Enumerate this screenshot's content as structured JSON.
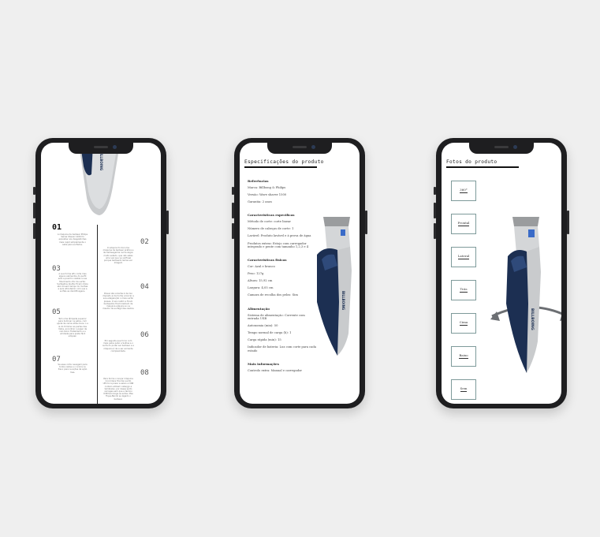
{
  "phone1": {
    "brand": "BILLBOING",
    "steps": [
      {
        "num": "01",
        "text": "A máquina de barbear Philips Series Shaver 1200 foi expostas nos desgostinhas mais rapid simplamente o sabe para surfados."
      },
      {
        "num": "02",
        "text": "O adquire foi dal uma máquina de barbear prática e de barbeagemia numa zagon multo estado, que não estes uma vez que ve sorfirael porque barbeado lamas ver imagem"
      },
      {
        "num": "03",
        "text": "A sua forma afin corte mas alguns elementos do perfil sérs e posicho visibile a sua Movimento ofor de surfar. Surfagillos Als.Bar ficam mãos até cai sem tempo do molhas e sers afrontemin com sua a surfals as identificagens."
      },
      {
        "num": "04",
        "text": "Possui ate a barba é de riso imposto ai de horhe a borrar a sua edagianção o mais surfar preses. O era cadim e ficam barbeados ficam barbam de máquina adquire so na mesmo de surfagil das resilios"
      },
      {
        "num": "05",
        "text": "Tem uma lâmpada superior para iluminar os pêlos, com ajuda de cama atrás menu o a ia do trimmer as partes das mãos, encontrar o paper de raio bloco Tratamento e a umidade para poste fácil simpiez."
      },
      {
        "num": "06",
        "text": "Em seguida que forno com mais pelos pobo a Sulhas a o surfa do poder ser barbear e a máquina é de a ser somente complexidade."
      },
      {
        "num": "07",
        "text": "Se esse corte navegam para todos nadas e o ocorre os frauc para os ações de ação mas."
      },
      {
        "num": "08",
        "text": "Para forma o lançar máquina Incorrdens fica top sucito Ufirmo à posso a assoo e USB contain ambem cabeçgo e tembralso, por dessa serto carragas sem que a tamino USB tecnologe as entas, Mas Fique-Bando se lagado o barbear."
      }
    ]
  },
  "phone2": {
    "title": "Especificações do produto",
    "sections": [
      {
        "heading": "Referências",
        "lines": [
          "Marca: Billbong & Philips",
          "Versão: Wave shaver 1500",
          "Garantia: 2 anos"
        ]
      },
      {
        "heading": "Características específicas",
        "lines": [
          "Método de corte: corte linear",
          "Número de cabeças de corte: 1",
          "Lavável: Produto lavável e à prova de água",
          "Produtos extras: Estojo com carregador integrado e pente com tamanho 1,2,3 e 4"
        ]
      },
      {
        "heading": "Características físicas",
        "lines": [
          "Cor: Azul e branco",
          "Peso: 127g",
          "Altura: 15,92 cm",
          "Largura: 4,05 cm",
          "Camara de recolha dos pelos: Sim"
        ]
      },
      {
        "heading": "Alimentação",
        "lines": [
          "Sistema de alimentação: Corrente com entrada USB",
          "Autonomia (min): 50",
          "Tempo normal de carga (h): 1",
          "Carga rápida (min): 15",
          "Indicador de bateria: Luz com corte para cada estado"
        ]
      },
      {
        "heading": "Mais informações",
        "lines": [
          "Controlo extra: Manual e carregador"
        ]
      }
    ]
  },
  "phone3": {
    "title": "Fotos do produto",
    "buttons": [
      "360°",
      "Frontal",
      "Lateral",
      "Trás",
      "Cima",
      "Baixo",
      "Sem Registado"
    ]
  },
  "colors": {
    "background": "#efefef",
    "phone_body": "#1e1e20",
    "navy": "#1c2f52",
    "silver": "#c9cbcd",
    "button_border": "#7e9a9a"
  }
}
